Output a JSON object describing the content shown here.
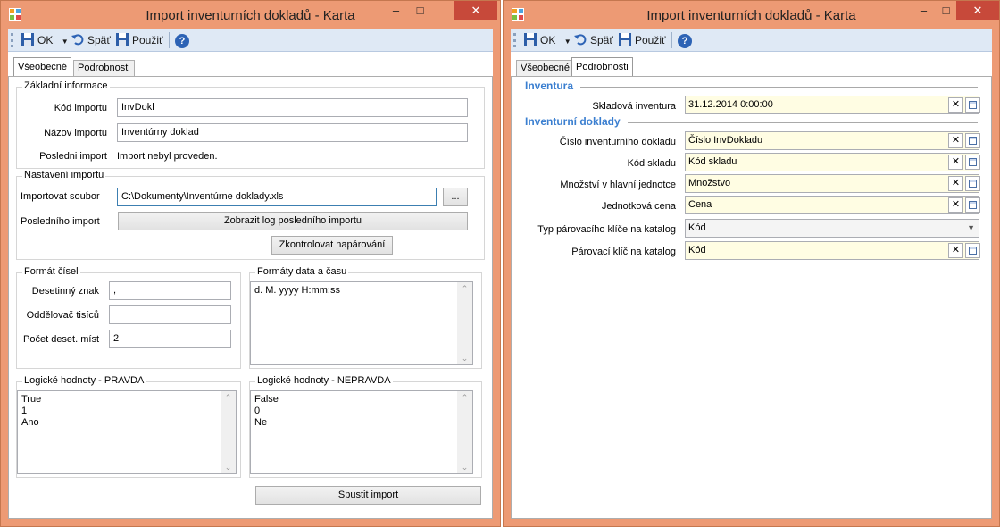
{
  "left_window": {
    "title": "Import inventurních dokladů - Karta",
    "controls": {
      "minimize": "–",
      "maximize": "□",
      "close": "✕"
    },
    "toolbar": {
      "ok": "OK",
      "back": "Späť",
      "apply": "Použiť",
      "help": "?"
    },
    "tabs": [
      "Všeobecné",
      "Podrobnosti"
    ],
    "basic_info": {
      "legend": "Základní informace",
      "code_label": "Kód importu",
      "code_value": "InvDokl",
      "name_label": "Názov importu",
      "name_value": "Inventúrny doklad",
      "last_label": "Posledni import",
      "last_value": "Import nebyl proveden."
    },
    "import_settings": {
      "legend": "Nastavení importu",
      "file_label": "Importovat soubor",
      "file_value": "C:\\Dokumenty\\Inventúrne doklady.xls",
      "browse": "...",
      "last_label": "Posledního import",
      "show_log": "Zobrazit log posledního importu",
      "check_pairing": "Zkontrolovat napárování"
    },
    "number_format": {
      "legend": "Formát čísel",
      "decimal_label": "Desetinný znak",
      "decimal_value": ",",
      "thousands_label": "Oddělovač tisíců",
      "thousands_value": "",
      "places_label": "Počet deset. míst",
      "places_value": "2"
    },
    "date_format": {
      "legend": "Formáty data a času",
      "lines": [
        "d. M. yyyy H:mm:ss"
      ]
    },
    "true_values": {
      "legend": "Logické hodnoty - PRAVDA",
      "lines": [
        "True",
        "1",
        "Ano"
      ]
    },
    "false_values": {
      "legend": "Logické hodnoty - NEPRAVDA",
      "lines": [
        "False",
        "0",
        "Ne"
      ]
    },
    "run_import": "Spustit import"
  },
  "right_window": {
    "title": "Import inventurních dokladů - Karta",
    "controls": {
      "minimize": "–",
      "maximize": "□",
      "close": "✕"
    },
    "toolbar": {
      "ok": "OK",
      "back": "Späť",
      "apply": "Použiť",
      "help": "?"
    },
    "tabs": [
      "Všeobecné",
      "Podrobnosti"
    ],
    "inventory_section": "Inventura",
    "inventory_fields": [
      {
        "label": "Skladová inventura",
        "value": "31.12.2014 0:00:00"
      }
    ],
    "docs_section": "Inventurní doklady",
    "doc_fields": [
      {
        "label": "Číslo inventurního dokladu",
        "value": "Číslo InvDokladu"
      },
      {
        "label": "Kód skladu",
        "value": "Kód skladu"
      },
      {
        "label": "Množství v hlavní jednotce",
        "value": "Množstvo"
      },
      {
        "label": "Jednotková cena",
        "value": "Cena"
      }
    ],
    "key_type": {
      "label": "Typ párovacího klíče na katalog",
      "value": "Kód"
    },
    "key": {
      "label": "Párovací klíč na katalog",
      "value": "Kód"
    }
  }
}
